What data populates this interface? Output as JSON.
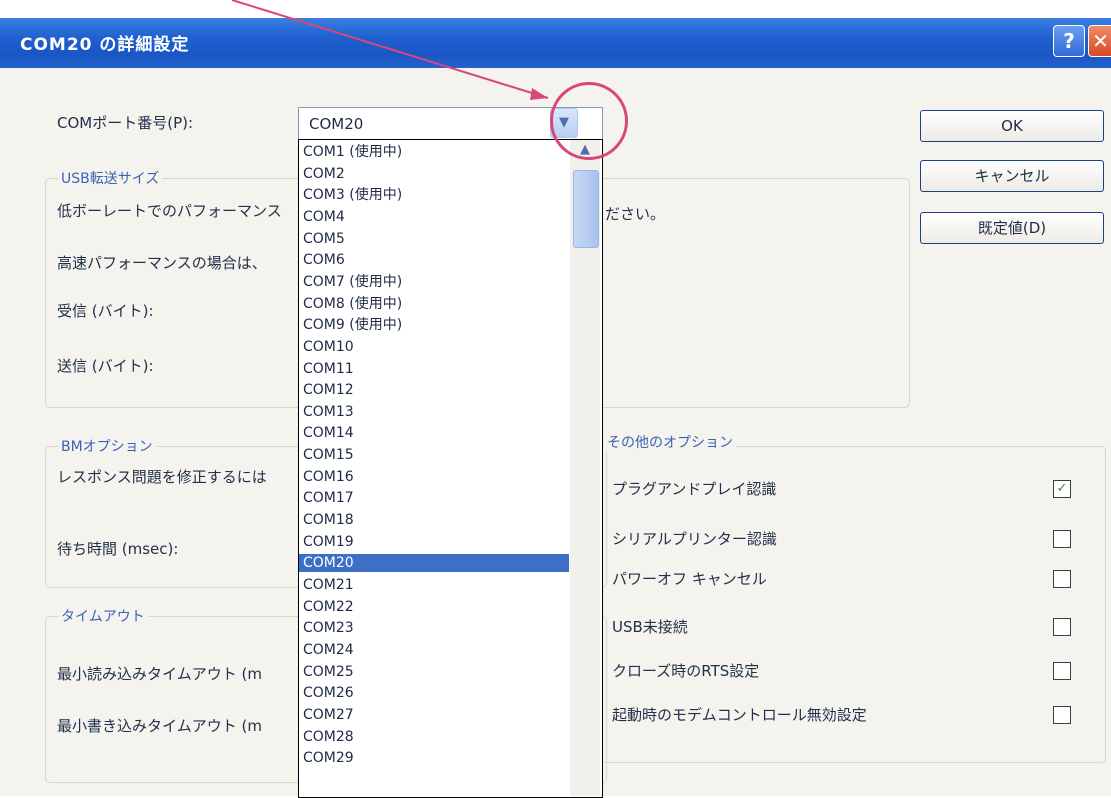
{
  "window": {
    "title": "COM20 の詳細設定",
    "help_glyph": "?",
    "close_glyph": "✕"
  },
  "com_port": {
    "label": "COMポート番号(P):",
    "selected": "COM20",
    "options": [
      "COM1 (使用中)",
      "COM2",
      "COM3 (使用中)",
      "COM4",
      "COM5",
      "COM6",
      "COM7 (使用中)",
      "COM8 (使用中)",
      "COM9 (使用中)",
      "COM10",
      "COM11",
      "COM12",
      "COM13",
      "COM14",
      "COM15",
      "COM16",
      "COM17",
      "COM18",
      "COM19",
      "COM20",
      "COM21",
      "COM22",
      "COM23",
      "COM24",
      "COM25",
      "COM26",
      "COM27",
      "COM28",
      "COM29"
    ],
    "selected_index": 19
  },
  "buttons": {
    "ok": "OK",
    "cancel": "キャンセル",
    "defaults": "既定値(D)"
  },
  "usb_transfer": {
    "legend": "USB転送サイズ",
    "line1": "低ボーレートでのパフォーマンス",
    "line1_tail": "ださい。",
    "line2": "高速パフォーマンスの場合は、",
    "receive": "受信 (バイト):",
    "send": "送信 (バイト):"
  },
  "bm_options": {
    "legend": "BMオプション",
    "line1": "レスポンス問題を修正するには",
    "wait": "待ち時間 (msec):"
  },
  "timeout": {
    "legend": "タイムアウト",
    "read": "最小読み込みタイムアウト (m",
    "write": "最小書き込みタイムアウト (m"
  },
  "other_options": {
    "legend": "その他のオプション",
    "items": [
      {
        "label": "プラグアンドプレイ認識",
        "checked": true
      },
      {
        "label": "シリアルプリンター認識",
        "checked": false
      },
      {
        "label": "パワーオフ キャンセル",
        "checked": false
      },
      {
        "label": "USB未接続",
        "checked": false
      },
      {
        "label": "クローズ時のRTS設定",
        "checked": false
      },
      {
        "label": "起動時のモデムコントロール無効設定",
        "checked": false
      }
    ]
  },
  "colors": {
    "title_bar": "#1f5fd0",
    "selection": "#3d6fc7",
    "annotation": "#d8467a"
  }
}
